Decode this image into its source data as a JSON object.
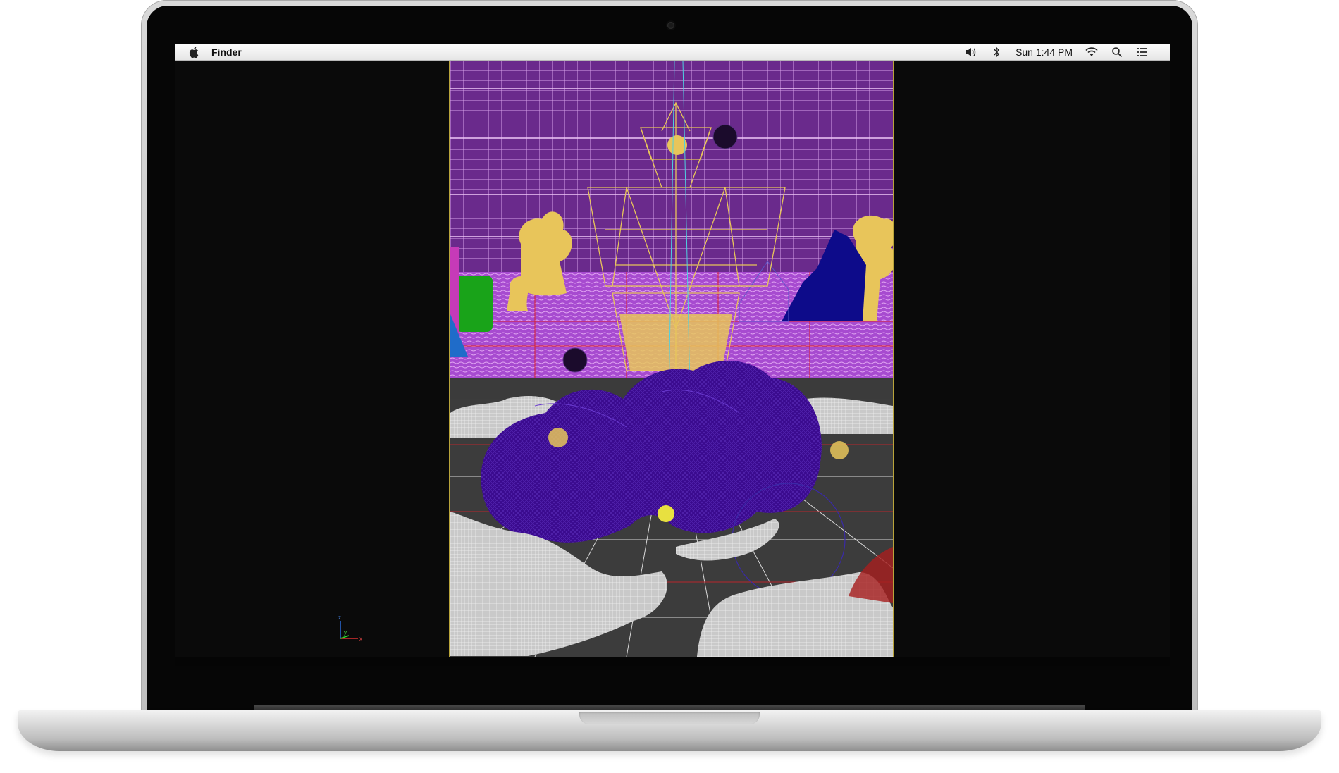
{
  "menubar": {
    "app_name": "Finder",
    "clock": "Sun 1:44 PM",
    "icons": [
      "apple-icon",
      "volume-icon",
      "bluetooth-icon",
      "wifi-icon",
      "search-icon",
      "list-icon"
    ]
  },
  "viewport": {
    "axis_labels": {
      "z": "z",
      "y": "y",
      "x": "x"
    }
  },
  "colors": {
    "sky": "#6b2a8a",
    "grid_major": "#d79ee8",
    "sea": "#b552d9",
    "ship": "#e8c55a",
    "rocks": "#3d0a8c",
    "land_light": "#cdcdcd",
    "mountain": "#0d0b8a",
    "tree": "#19a319",
    "floor_grid_red": "#c0202a"
  }
}
